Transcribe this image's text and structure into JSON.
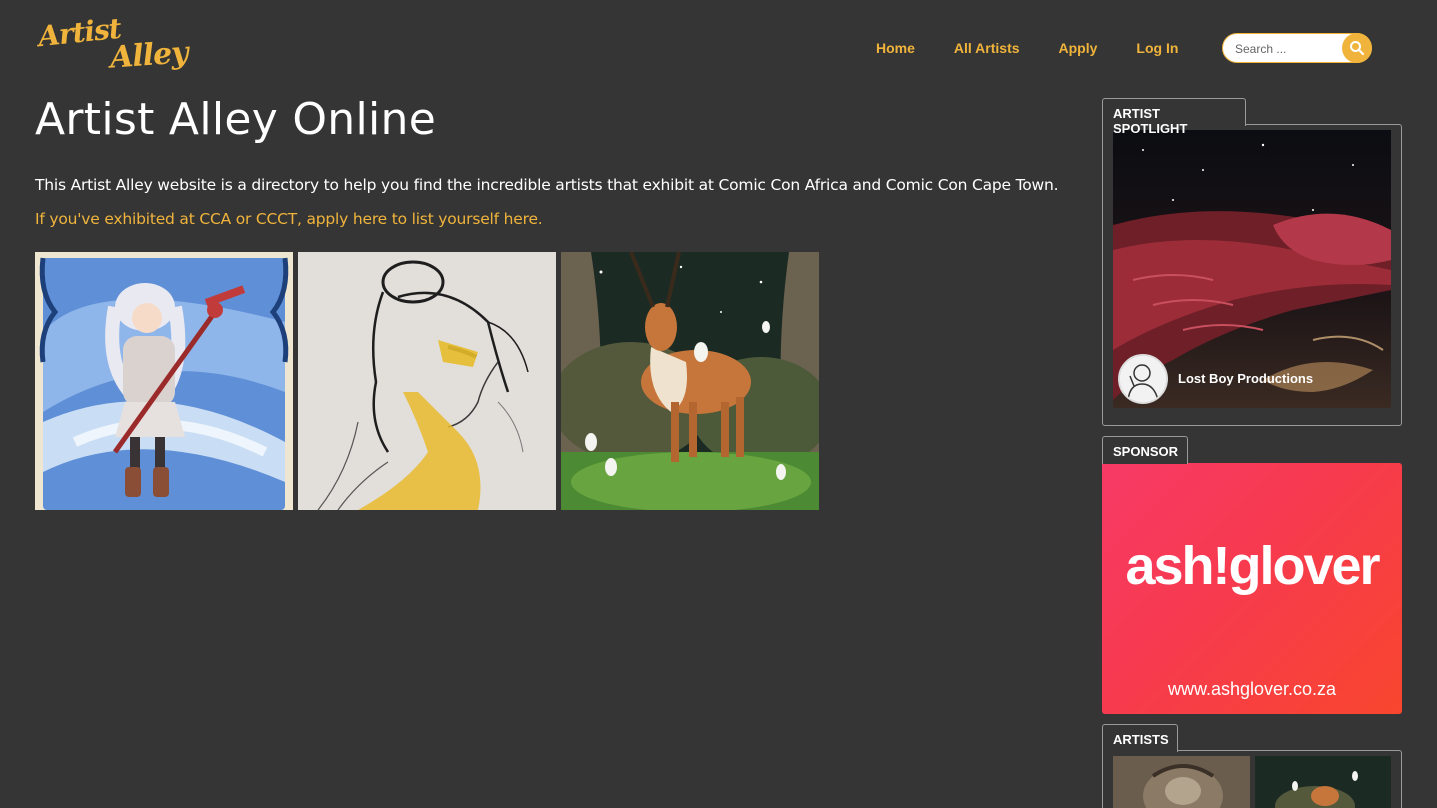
{
  "header": {
    "logo_line1": "Artist",
    "logo_line2": "Alley",
    "nav": [
      "Home",
      "All Artists",
      "Apply",
      "Log In"
    ],
    "search_placeholder": "Search ..."
  },
  "main": {
    "title": "Artist Alley Online",
    "intro": "This Artist Alley website is a directory to help you find the incredible artists that exhibit at Comic Con Africa and Comic Con Cape Town.",
    "apply_link": "If you've exhibited at CCA or CCCT, apply here to list yourself here."
  },
  "sidebar": {
    "spotlight_title": "ARTIST SPOTLIGHT",
    "spotlight_artist": "Lost Boy Productions",
    "sponsor_title": "SPONSOR",
    "sponsor_brand": "ash!glover",
    "sponsor_url": "www.ashglover.co.za",
    "artists_title": "ARTISTS"
  },
  "colors": {
    "background": "#353535",
    "accent": "#f0b43c",
    "sponsor_red": "#f73a4e"
  },
  "icons": {
    "search": "magnifier-icon"
  }
}
